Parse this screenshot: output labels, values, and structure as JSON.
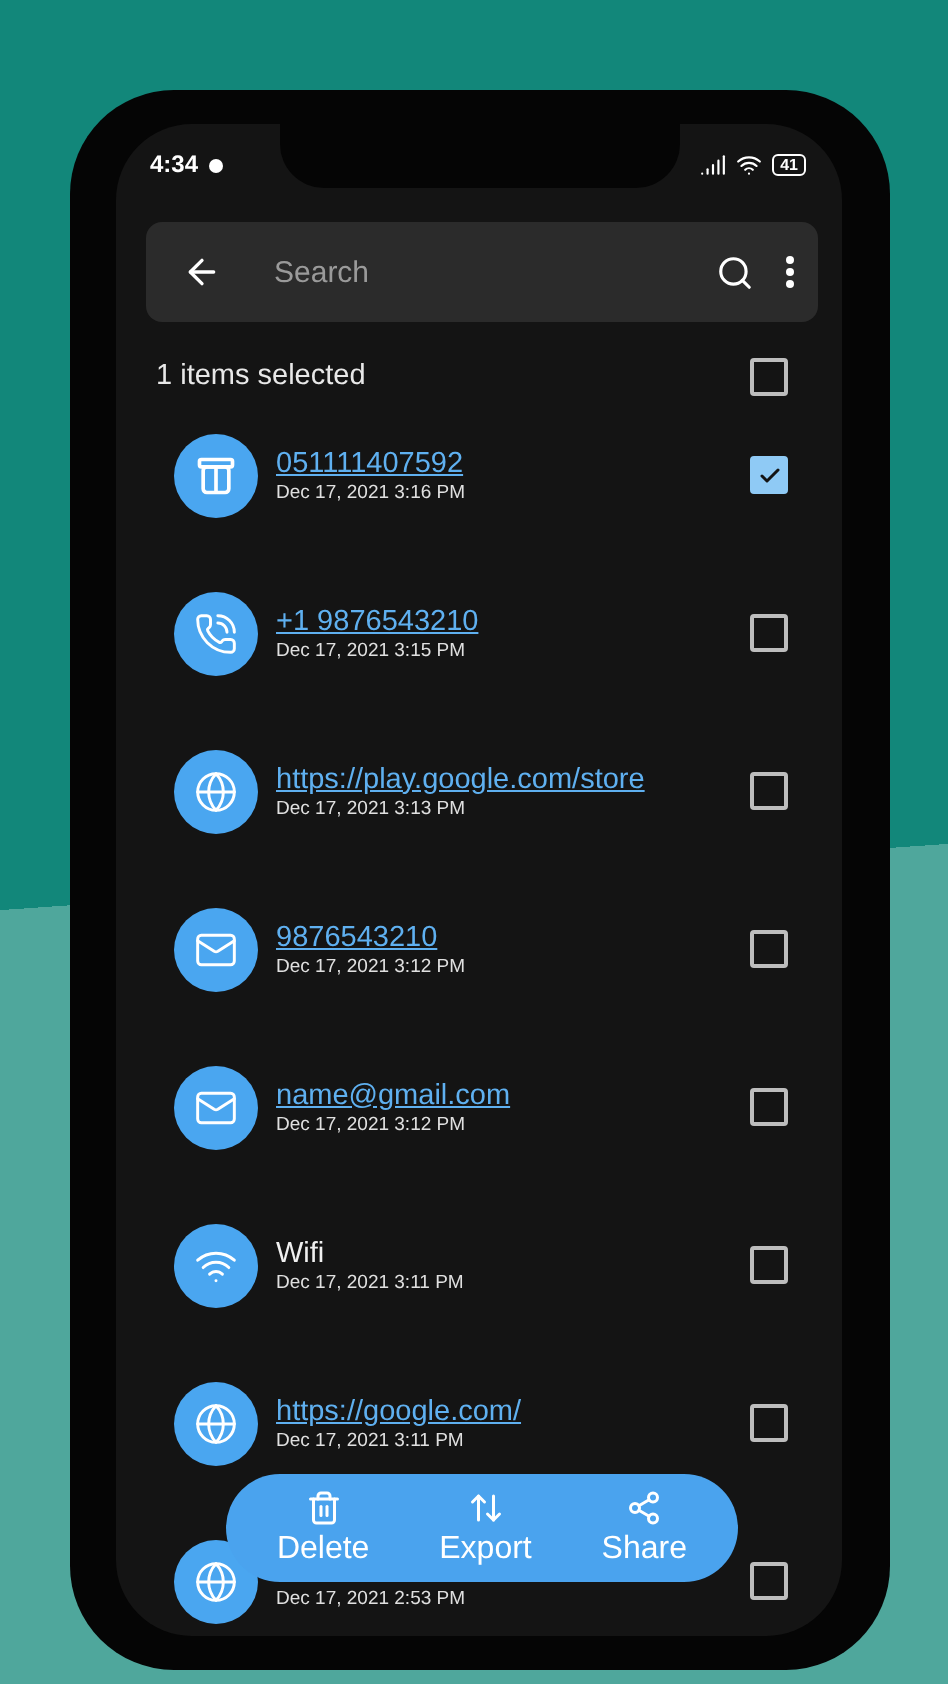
{
  "status_bar": {
    "time": "4:34",
    "battery": "41"
  },
  "search": {
    "placeholder": "Search"
  },
  "selection": {
    "label": "1 items selected",
    "checked": false
  },
  "items": [
    {
      "kind": "product",
      "title": "051111407592",
      "link": true,
      "date": "Dec 17, 2021 3:16 PM",
      "checked": true
    },
    {
      "kind": "phone",
      "title": "+1 9876543210",
      "link": true,
      "date": "Dec 17, 2021 3:15 PM",
      "checked": false
    },
    {
      "kind": "web",
      "title": "https://play.google.com/store",
      "link": true,
      "date": "Dec 17, 2021 3:13 PM",
      "checked": false
    },
    {
      "kind": "mail",
      "title": "9876543210",
      "link": true,
      "date": "Dec 17, 2021 3:12 PM",
      "checked": false
    },
    {
      "kind": "mail",
      "title": "name@gmail.com",
      "link": true,
      "date": "Dec 17, 2021 3:12 PM",
      "checked": false
    },
    {
      "kind": "wifi",
      "title": "Wifi",
      "link": false,
      "date": "Dec 17, 2021 3:11 PM",
      "checked": false
    },
    {
      "kind": "web",
      "title": "https://google.com/",
      "link": true,
      "date": "Dec 17, 2021 3:11 PM",
      "checked": false
    },
    {
      "kind": "web",
      "date": "Dec 17, 2021 2:53 PM",
      "checked": false
    }
  ],
  "actions": [
    {
      "kind": "delete",
      "label": "Delete"
    },
    {
      "kind": "export",
      "label": "Export"
    },
    {
      "kind": "share",
      "label": "Share"
    }
  ]
}
